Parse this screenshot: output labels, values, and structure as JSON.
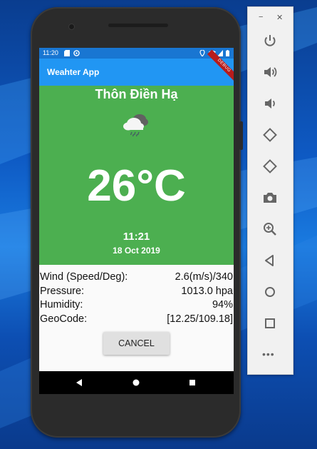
{
  "status_bar": {
    "time": "11:20"
  },
  "app_bar": {
    "title": "Weahter App",
    "debug_banner": "DEBUG"
  },
  "weather": {
    "city": "Thôn Điền Hạ",
    "icon": "rain-cloud-icon",
    "temperature": "26°C",
    "time": "11:21",
    "date": "18 Oct 2019"
  },
  "details": [
    {
      "label": "Wind (Speed/Deg):",
      "value": "2.6(m/s)/340"
    },
    {
      "label": "Pressure:",
      "value": "1013.0 hpa"
    },
    {
      "label": "Humidity:",
      "value": "94%"
    },
    {
      "label": "GeoCode:",
      "value": "[12.25/109.18]"
    }
  ],
  "actions": {
    "cancel_label": "CANCEL"
  },
  "emulator_panel": {
    "minimize": "−",
    "close": "✕",
    "more": "•••",
    "buttons": [
      "power-icon",
      "volume-up-icon",
      "volume-down-icon",
      "rotate-left-icon",
      "rotate-right-icon",
      "camera-icon",
      "zoom-icon",
      "back-icon",
      "home-icon",
      "overview-icon"
    ]
  },
  "colors": {
    "status_bar": "#1976d2",
    "app_bar": "#2196f3",
    "weather_bg": "#4caf50",
    "button_bg": "#e0e0e0"
  }
}
